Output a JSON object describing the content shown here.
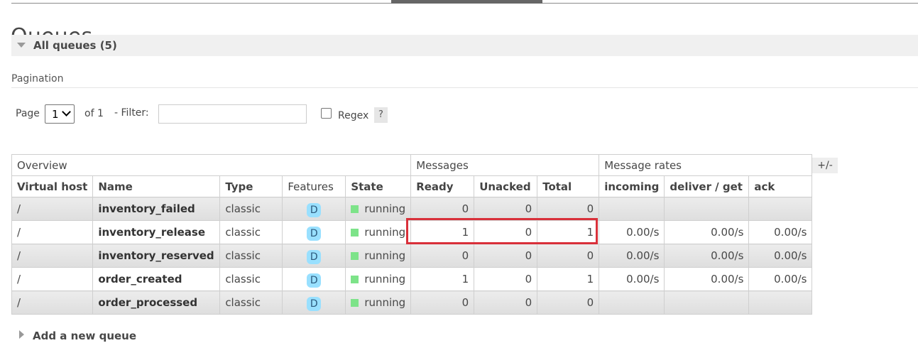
{
  "page_title": "Queues",
  "section": {
    "label": "All queues (5)"
  },
  "pagination": {
    "label": "Pagination",
    "page_label": "Page",
    "page_value": "1",
    "of_label": "of 1",
    "filter_label": "- Filter:",
    "filter_value": "",
    "regex_label": "Regex",
    "help_label": "?"
  },
  "table": {
    "groups": {
      "overview": "Overview",
      "messages": "Messages",
      "rates": "Message rates"
    },
    "columns": [
      "Virtual host",
      "Name",
      "Type",
      "Features",
      "State",
      "Ready",
      "Unacked",
      "Total",
      "incoming",
      "deliver / get",
      "ack"
    ],
    "plus_minus": "+/-",
    "rows": [
      {
        "vhost": "/",
        "name": "inventory_failed",
        "type": "classic",
        "feature": "D",
        "state": "running",
        "ready": "0",
        "unacked": "0",
        "total": "0",
        "incoming": "",
        "deliver": "",
        "ack": ""
      },
      {
        "vhost": "/",
        "name": "inventory_release",
        "type": "classic",
        "feature": "D",
        "state": "running",
        "ready": "1",
        "unacked": "0",
        "total": "1",
        "incoming": "0.00/s",
        "deliver": "0.00/s",
        "ack": "0.00/s"
      },
      {
        "vhost": "/",
        "name": "inventory_reserved",
        "type": "classic",
        "feature": "D",
        "state": "running",
        "ready": "0",
        "unacked": "0",
        "total": "0",
        "incoming": "0.00/s",
        "deliver": "0.00/s",
        "ack": "0.00/s"
      },
      {
        "vhost": "/",
        "name": "order_created",
        "type": "classic",
        "feature": "D",
        "state": "running",
        "ready": "1",
        "unacked": "0",
        "total": "1",
        "incoming": "0.00/s",
        "deliver": "0.00/s",
        "ack": "0.00/s"
      },
      {
        "vhost": "/",
        "name": "order_processed",
        "type": "classic",
        "feature": "D",
        "state": "running",
        "ready": "0",
        "unacked": "0",
        "total": "0",
        "incoming": "",
        "deliver": "",
        "ack": ""
      }
    ]
  },
  "add_queue": {
    "label": "Add a new queue"
  },
  "colors": {
    "running": "#7de389",
    "feature_badge": "#99e0ff",
    "highlight": "#d9303a"
  }
}
